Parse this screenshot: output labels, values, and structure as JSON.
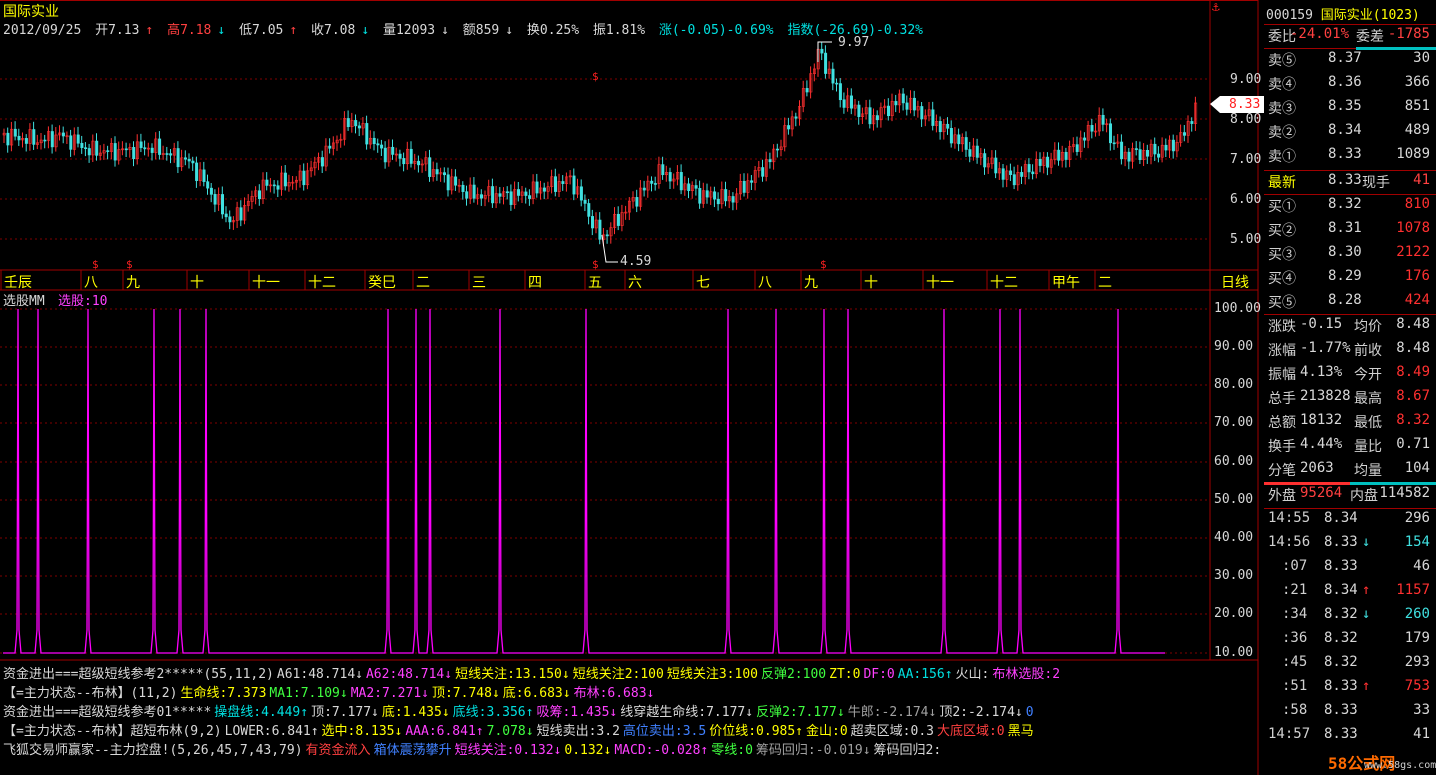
{
  "stock": {
    "name": "国际实业"
  },
  "info_bar": {
    "date": "2012/09/25",
    "open": "开7.13",
    "high": "高7.18",
    "low": "低7.05",
    "close": "收7.08",
    "vol": "量12093",
    "amount": "额859",
    "turnover": "换0.25%",
    "amplitude": "振1.81%",
    "change": "涨(-0.05)-0.69%",
    "index": "指数(-26.69)-0.32%"
  },
  "price_axis": [
    "9.00",
    "8.00",
    "7.00",
    "6.00",
    "5.00"
  ],
  "price_tag": "8.33",
  "high_mark": "9.97",
  "low_mark": "4.59",
  "months": [
    "壬辰",
    "八",
    "九",
    "十",
    "十一",
    "十二",
    "癸巳",
    "二",
    "三",
    "四",
    "五",
    "六",
    "七",
    "八",
    "九",
    "十",
    "十一",
    "十二",
    "甲午",
    "二"
  ],
  "period_label": "日线",
  "indicator": {
    "name": "选股MM",
    "label": "选股:10"
  },
  "ind_axis": [
    "100.00",
    "90.00",
    "80.00",
    "70.00",
    "60.00",
    "50.00",
    "40.00",
    "30.00",
    "20.00",
    "10.00"
  ],
  "bottom_lines": [
    [
      [
        "c-w",
        "资金进出===超级短线参考2*****(55,11,2)"
      ],
      [
        "c-w",
        "A61:48.714↓"
      ],
      [
        "c-m",
        "A62:48.714↓"
      ],
      [
        "c-y",
        "短线关注:13.150↓"
      ],
      [
        "c-y",
        "短线关注2:100"
      ],
      [
        "c-y",
        "短线关注3:100"
      ],
      [
        "c-lg",
        "反弹2:100"
      ],
      [
        "c-y",
        "ZT:0"
      ],
      [
        "c-m",
        "DF:0"
      ],
      [
        "c-g",
        "AA:156↑"
      ],
      [
        "c-w",
        "火山:"
      ],
      [
        "c-m",
        "布林选股:2"
      ]
    ],
    [
      [
        "c-w",
        "【=主力状态--布林】(11,2)"
      ],
      [
        "c-y",
        "生命线:7.373"
      ],
      [
        "c-lg",
        "MA1:7.109↓"
      ],
      [
        "c-m",
        "MA2:7.271↓"
      ],
      [
        "c-y",
        "顶:7.748↓"
      ],
      [
        "c-y",
        "底:6.683↓"
      ],
      [
        "c-m",
        "布林:6.683↓"
      ]
    ],
    [
      [
        "c-w",
        "资金进出===超级短线参考01*****"
      ],
      [
        "c-g",
        "操盘线:4.449↑"
      ],
      [
        "c-w",
        "顶:7.177↓"
      ],
      [
        "c-y",
        "底:1.435↓"
      ],
      [
        "c-g",
        "底线:3.356↑"
      ],
      [
        "c-m",
        "吸筹:1.435↓"
      ],
      [
        "c-w",
        "线穿越生命线:7.177↓"
      ],
      [
        "c-lg",
        "反弹2:7.177↓"
      ],
      [
        "c-gr",
        "牛郎:-2.174↓"
      ],
      [
        "c-w",
        "顶2:-2.174↓"
      ],
      [
        "c-b",
        "0"
      ]
    ],
    [
      [
        "c-w",
        "【=主力状态--布林】超短布林(9,2)"
      ],
      [
        "c-w",
        "LOWER:6.841↑"
      ],
      [
        "c-y",
        "选中:8.135↓"
      ],
      [
        "c-m",
        "AAA:6.841↑"
      ],
      [
        "c-lg",
        "7.078↓"
      ],
      [
        "c-w",
        "短线卖出:3.2"
      ],
      [
        "c-b",
        "高位卖出:3.5"
      ],
      [
        "c-y",
        "价位线:0.985↑"
      ],
      [
        "c-y",
        "金山:0"
      ],
      [
        "c-w",
        "超卖区域:0.3"
      ],
      [
        "c-r",
        "大底区域:0"
      ],
      [
        "c-y",
        "黑马"
      ]
    ],
    [
      [
        "c-w",
        "飞狐交易师赢家--主力控盘!(5,26,45,7,43,79)"
      ],
      [
        "c-r",
        "有资金流入"
      ],
      [
        "c-b",
        "箱体震荡攀升"
      ],
      [
        "c-m",
        "短线关注:0.132↓"
      ],
      [
        "c-y",
        "0.132↓"
      ],
      [
        "c-m",
        "MACD:-0.028↑"
      ],
      [
        "c-lg",
        "零线:0"
      ],
      [
        "c-gr",
        "筹码回归:-0.019↓"
      ],
      [
        "c-w",
        "筹码回归2:"
      ]
    ]
  ],
  "quote": {
    "code": "000159",
    "name": "国际实业(1023)",
    "webi_label": "委比",
    "webi_val": "-24.01%",
    "wecha_label": "委差",
    "wecha_val": "-1785",
    "sells": [
      [
        "卖⑤",
        "8.37",
        "30"
      ],
      [
        "卖④",
        "8.36",
        "366"
      ],
      [
        "卖③",
        "8.35",
        "851"
      ],
      [
        "卖②",
        "8.34",
        "489"
      ],
      [
        "卖①",
        "8.33",
        "1089"
      ]
    ],
    "latest_label": "最新",
    "latest": "8.33",
    "hand_label": "现手",
    "hand": "41",
    "buys": [
      [
        "买①",
        "8.32",
        "810"
      ],
      [
        "买②",
        "8.31",
        "1078"
      ],
      [
        "买③",
        "8.30",
        "2122"
      ],
      [
        "买④",
        "8.29",
        "176"
      ],
      [
        "买⑤",
        "8.28",
        "424"
      ]
    ],
    "stats": [
      [
        "涨跌",
        "-0.15",
        "均价",
        "8.48"
      ],
      [
        "涨幅",
        "-1.77%",
        "前收",
        "8.48"
      ],
      [
        "振幅",
        "4.13%",
        "今开",
        "8.49"
      ],
      [
        "总手",
        "213828",
        "最高",
        "8.67"
      ],
      [
        "总额",
        "18132",
        "最低",
        "8.32"
      ],
      [
        "换手",
        "4.44%",
        "量比",
        "0.71"
      ],
      [
        "分笔",
        "2063",
        "均量",
        "104"
      ]
    ],
    "waipan_label": "外盘",
    "waipan": "95264",
    "neipan_label": "内盘",
    "neipan": "114582",
    "ticks": [
      [
        "14:55",
        "8.34",
        "",
        "296"
      ],
      [
        "14:56",
        "8.33",
        "↓",
        "154"
      ],
      [
        ":07",
        "8.33",
        "",
        "46"
      ],
      [
        ":21",
        "8.34",
        "↑",
        "1157"
      ],
      [
        ":34",
        "8.32",
        "↓",
        "260"
      ],
      [
        ":36",
        "8.32",
        "",
        "179"
      ],
      [
        ":45",
        "8.32",
        "",
        "293"
      ],
      [
        ":51",
        "8.33",
        "↑",
        "753"
      ],
      [
        ":58",
        "8.33",
        "",
        "33"
      ],
      [
        "14:57",
        "8.33",
        "",
        "41"
      ]
    ]
  },
  "watermark": "58公式网",
  "watermark_url": "www.58gs.com"
}
